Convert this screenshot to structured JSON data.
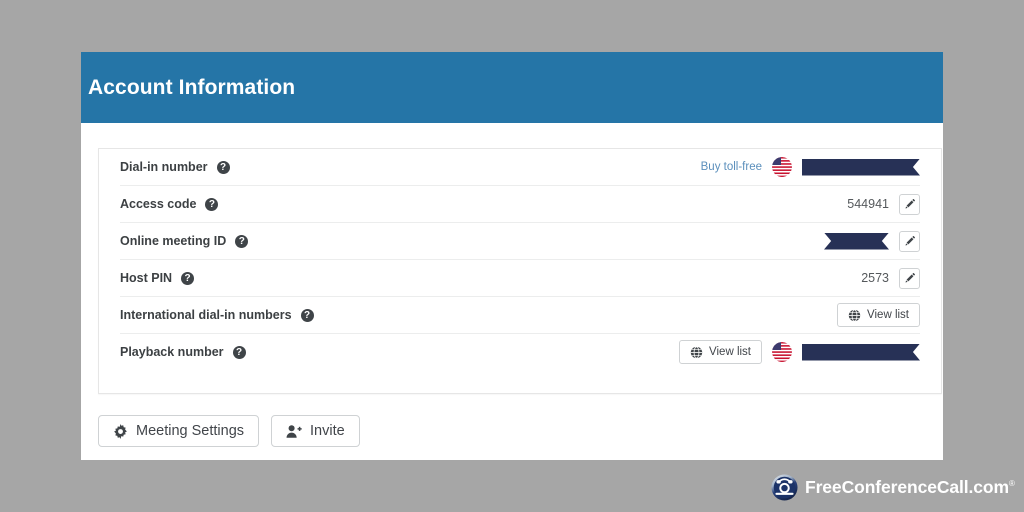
{
  "header": {
    "title": "Account Information"
  },
  "rows": [
    {
      "id": "dial-in-number",
      "label": "Dial-in number",
      "help_icon": "question-circle-icon",
      "link_label": "Buy toll-free",
      "flag_icon": "us-flag-icon",
      "redacted": true,
      "redaction_style": "notch-right",
      "value": "",
      "edit_icon": null,
      "button_label": null
    },
    {
      "id": "access-code",
      "label": "Access code",
      "help_icon": "question-circle-icon",
      "link_label": null,
      "flag_icon": null,
      "redacted": false,
      "redaction_style": null,
      "value": "544941",
      "edit_icon": "pencil-icon",
      "button_label": null
    },
    {
      "id": "online-meeting-id",
      "label": "Online meeting ID",
      "help_icon": "question-circle-icon",
      "link_label": null,
      "flag_icon": null,
      "redacted": true,
      "redaction_style": "notch-both",
      "value": "",
      "edit_icon": "pencil-icon",
      "button_label": null
    },
    {
      "id": "host-pin",
      "label": "Host PIN",
      "help_icon": "question-circle-icon",
      "link_label": null,
      "flag_icon": null,
      "redacted": false,
      "redaction_style": null,
      "value": "2573",
      "edit_icon": "pencil-icon",
      "button_label": null
    },
    {
      "id": "international-dial-in-numbers",
      "label": "International dial-in numbers",
      "help_icon": "question-circle-icon",
      "link_label": null,
      "flag_icon": null,
      "redacted": false,
      "redaction_style": null,
      "value": "",
      "edit_icon": null,
      "button_label": "View list",
      "button_icon": "globe-icon"
    },
    {
      "id": "playback-number",
      "label": "Playback number",
      "help_icon": "question-circle-icon",
      "link_label": null,
      "flag_icon": "us-flag-icon",
      "redacted": true,
      "redaction_style": "notch-right",
      "value": "",
      "edit_icon": null,
      "button_label": "View list",
      "button_icon": "globe-icon"
    }
  ],
  "actions": [
    {
      "id": "meeting-settings",
      "label": "Meeting Settings",
      "icon": "gear-icon"
    },
    {
      "id": "invite",
      "label": "Invite",
      "icon": "user-plus-icon"
    }
  ],
  "footer": {
    "logo_icon": "telephone-circle-icon",
    "brand": "FreeConferenceCall.com",
    "registered_mark": "®"
  },
  "colors": {
    "page_background": "#a6a6a6",
    "header_blue": "#2575a7",
    "panel_white": "#ffffff",
    "redaction_navy": "#273156",
    "link_blue": "#5b8fbc",
    "label_text": "#3c4043",
    "divider": "#eceded"
  }
}
